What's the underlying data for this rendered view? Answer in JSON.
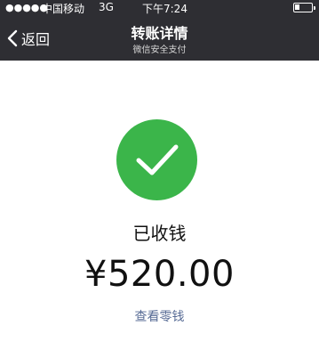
{
  "status_bar": {
    "signal": "●●●●●",
    "carrier": "中国移动",
    "network": "3G",
    "time": "下午7:24",
    "battery_icon": "battery-icon"
  },
  "nav": {
    "back_label": "返回",
    "title": "转账详情",
    "subtitle": "微信安全支付"
  },
  "receipt": {
    "status": "已收钱",
    "amount": "¥520.00",
    "link_label": "查看零钱",
    "icon": "checkmark-icon"
  },
  "colors": {
    "bar": "#2e2e33",
    "success": "#3bb54a",
    "link": "#576b95"
  }
}
